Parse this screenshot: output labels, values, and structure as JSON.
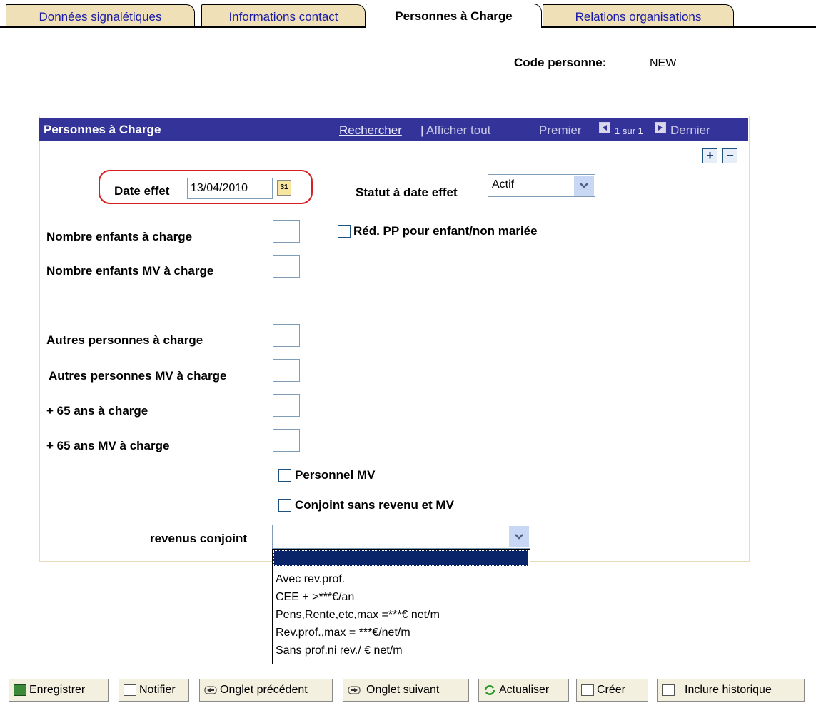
{
  "tabs": [
    {
      "label": "Données signalétiques",
      "active": false
    },
    {
      "label": "Informations contact",
      "active": false
    },
    {
      "label": "Personnes à Charge",
      "active": true
    },
    {
      "label": "Relations organisations",
      "active": false
    }
  ],
  "header": {
    "code_label": "Code personne:",
    "code_value": "NEW"
  },
  "panel": {
    "title": "Personnes à Charge",
    "search_link": "Rechercher",
    "separator": "|",
    "show_all": "Afficher tout",
    "first": "Premier",
    "pager": "1 sur 1",
    "last": "Dernier",
    "add_symbol": "+",
    "remove_symbol": "−"
  },
  "form": {
    "date_effet_label": "Date effet",
    "date_effet_value": "13/04/2010",
    "statut_label": "Statut à date effet",
    "statut_value": "Actif",
    "nb_enfants_label": "Nombre enfants à charge",
    "nb_enfants_mv_label": "Nombre enfants MV à charge",
    "red_pp_label": "Réd. PP pour enfant/non mariée",
    "autres_label": "Autres personnes à charge",
    "autres_mv_label": "Autres personnes MV à charge",
    "plus65_label": "+ 65 ans à charge",
    "plus65_mv_label": "+ 65 ans MV à charge",
    "personnel_mv_label": "Personnel MV",
    "conjoint_label": "Conjoint sans revenu et MV",
    "revenus_label": "revenus conjoint",
    "revenus_value": "",
    "revenus_options": [
      "",
      "Avec rev.prof.",
      "CEE + >***€/an",
      "Pens,Rente,etc,max =***€ net/m",
      "Rev.prof.,max = ***€/net/m",
      "Sans prof.ni rev./ € net/m"
    ]
  },
  "toolbar": {
    "save": "Enregistrer",
    "notify": "Notifier",
    "prev_tab": "Onglet précédent",
    "next_tab": "Onglet suivant",
    "refresh": "Actualiser",
    "create": "Créer",
    "history": "Inclure historique"
  },
  "colors": {
    "tab_bg": "#efe0b8",
    "panel_header": "#33339a",
    "link": "#1a1aa8",
    "highlight_oval": "#d92020",
    "dropdown_selected": "#0a246a"
  }
}
